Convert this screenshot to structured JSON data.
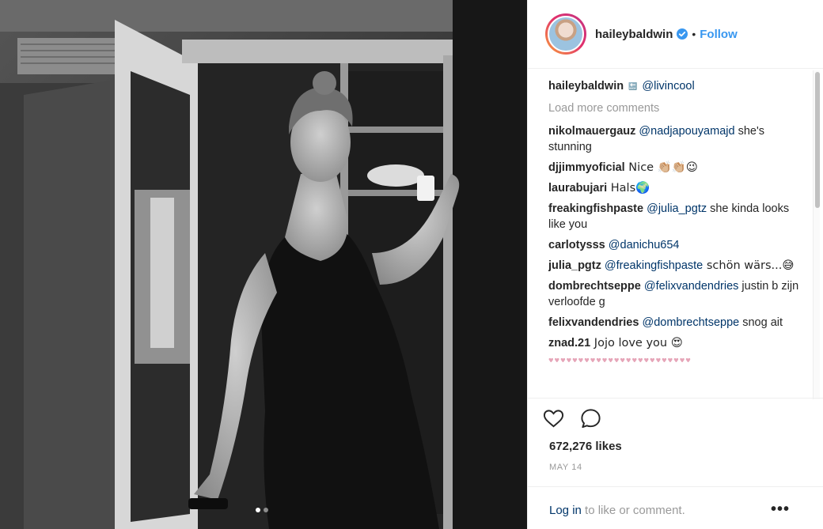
{
  "post": {
    "author": "haileybaldwin",
    "follow_label": "Follow",
    "separator": "•",
    "caption_mention": "@livincool",
    "caption_back_label": "BACK",
    "load_more": "Load more comments",
    "likes": "672,276 likes",
    "date": "MAY 14",
    "login_link": "Log in",
    "login_rest": " to like or comment.",
    "more_label": "•••",
    "accent_color": "#3897f0"
  },
  "comments": [
    {
      "user": "nikolmauergauz",
      "mention": "@nadjapouyamajd",
      "text": " she's stunning"
    },
    {
      "user": "djjimmyoficial",
      "mention": "",
      "text": " Nice 👏🏼👏🏼😉"
    },
    {
      "user": "laurabujari",
      "mention": "",
      "text": " Hals🌍"
    },
    {
      "user": "freakingfishpaste",
      "mention": "@julia_pgtz",
      "text": " she kinda looks like you"
    },
    {
      "user": "carlotysss",
      "mention": "@danichu654",
      "text": ""
    },
    {
      "user": "julia_pgtz",
      "mention": "@freakingfishpaste",
      "text": " schön wärs...😅"
    },
    {
      "user": "dombrechtseppe",
      "mention": "@felixvandendries",
      "text": " justin b zijn verloofde g"
    },
    {
      "user": "felixvandendries",
      "mention": "@dombrechtseppe",
      "text": " snog ait"
    },
    {
      "user": "znad.21",
      "mention": "",
      "text": " Jojo love you 😍"
    }
  ],
  "icons": [
    "verified-badge-icon",
    "heart-icon",
    "comment-icon",
    "more-options-icon"
  ]
}
